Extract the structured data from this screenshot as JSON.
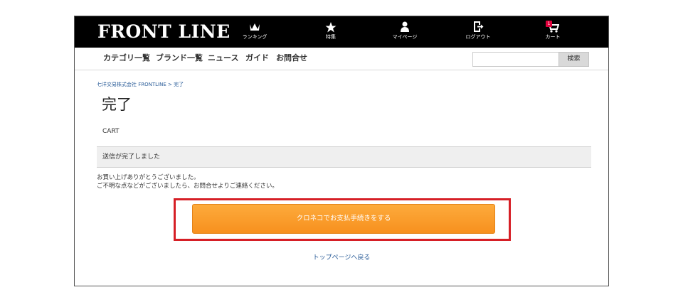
{
  "header": {
    "logo": "FRONT LINE",
    "nav": [
      {
        "label": "ランキング",
        "icon": "crown-icon"
      },
      {
        "label": "特集",
        "icon": "star-icon"
      },
      {
        "label": "マイページ",
        "icon": "user-icon"
      },
      {
        "label": "ログアウト",
        "icon": "logout-icon"
      },
      {
        "label": "カート",
        "icon": "cart-icon",
        "badge": "1"
      }
    ]
  },
  "category_nav": [
    "カテゴリ一覧",
    "ブランド一覧",
    "ニュース",
    "ガイド",
    "お問合せ"
  ],
  "search": {
    "placeholder": "",
    "button_label": "検索"
  },
  "breadcrumb": "七洋交易株式会社 FRONTLINE > 完了",
  "page": {
    "title": "完了",
    "section_label": "CART",
    "notice": "送信が完了しました",
    "message_line1": "お買い上げありがとうございました。",
    "message_line2": "ご不明な点などがございましたら、お問合せよりご連絡ください。",
    "pay_button": "クロネコでお支払手続きをする",
    "back_link": "トップページへ戻る"
  },
  "colors": {
    "accent": "#f7901e",
    "highlight": "#d61f26",
    "link": "#2a5c98",
    "header_bg": "#000000"
  }
}
